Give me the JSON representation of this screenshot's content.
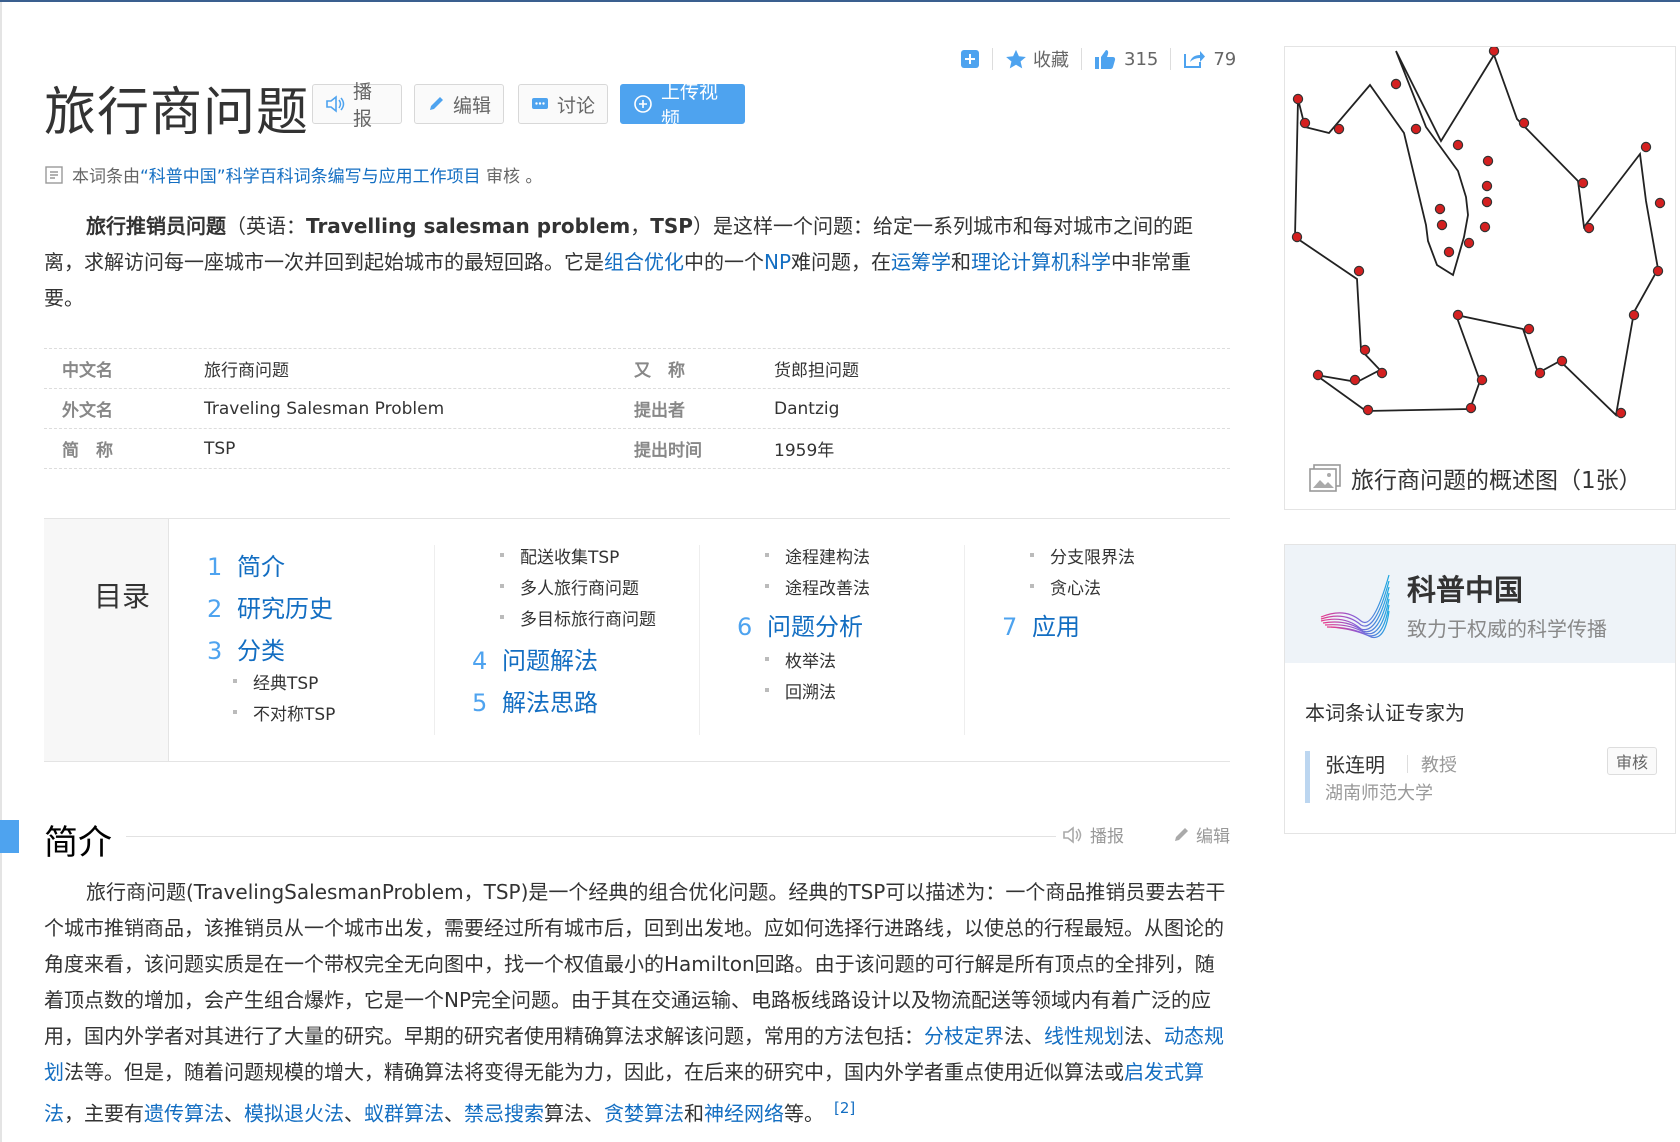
{
  "page": {
    "title": "旅行商问题",
    "buttons": {
      "broadcast": "播报",
      "edit": "编辑",
      "discuss": "讨论",
      "upload_video": "上传视频"
    },
    "top_actions": {
      "favorite": "收藏",
      "likes": "315",
      "shares": "79"
    },
    "review_note": {
      "prefix": "本词条由",
      "link": "“科普中国”科学百科词条编写与应用工作项目",
      "suffix": " 审核 。"
    }
  },
  "summary": {
    "bold_term": "旅行推销员问题",
    "part1": "（英语：",
    "english": "Travelling salesman problem",
    "part2": "，",
    "abbr": "TSP",
    "part3": "）是这样一个问题：给定一系列城市和每对城市之间的距离，求解访问每一座城市一次并回到起始城市的最短回路。它是",
    "link1": "组合优化",
    "part4": "中的一个",
    "link2": "NP",
    "part5": "难问题，在",
    "link3": "运筹学",
    "part6": "和",
    "link4": "理论计算机科学",
    "part7": "中非常重要。"
  },
  "info_table": [
    {
      "k1": "中文名",
      "v1": "旅行商问题",
      "k2": "又　称",
      "v2": "货郎担问题"
    },
    {
      "k1": "外文名",
      "v1": "Traveling Salesman Problem",
      "k2": "提出者",
      "v2": "Dantzig"
    },
    {
      "k1": "简　称",
      "v1": "TSP",
      "k2": "提出时间",
      "v2": "1959年"
    }
  ],
  "toc": {
    "label": "目录",
    "l1": [
      {
        "n": "1",
        "t": "简介"
      },
      {
        "n": "2",
        "t": "研究历史"
      },
      {
        "n": "3",
        "t": "分类"
      },
      {
        "n": "4",
        "t": "问题解法"
      },
      {
        "n": "5",
        "t": "解法思路"
      },
      {
        "n": "6",
        "t": "问题分析"
      },
      {
        "n": "7",
        "t": "应用"
      }
    ],
    "l2": [
      "经典TSP",
      "不对称TSP",
      "配送收集TSP",
      "多人旅行商问题",
      "多目标旅行商问题",
      "途程建构法",
      "途程改善法",
      "枚举法",
      "回溯法",
      "分支限界法",
      "贪心法"
    ]
  },
  "section": {
    "title": "简介",
    "broadcast": "播报",
    "edit": "编辑"
  },
  "intro": {
    "t1": "旅行商问题(TravelingSalesmanProblem，TSP)是一个经典的组合优化问题。经典的TSP可以描述为：一个商品推销员要去若干个城市推销商品，该推销员从一个城市出发，需要经过所有城市后，回到出发地。应如何选择行进路线，以使总的行程最短。从图论的角度来看，该问题实质是在一个带权完全无向图中，找一个权值最小的Hamilton回路。由于该问题的可行解是所有顶点的全排列，随着顶点数的增加，会产生组合爆炸，它是一个NP完全问题。由于其在交通运输、电路板线路设计以及物流配送等领域内有着广泛的应用，国内外学者对其进行了大量的研究。早期的研究者使用精确算法求解该问题，常用的方法包括：",
    "a1": "分枝定界",
    "t2": "法、",
    "a2": "线性规划",
    "t3": "法、",
    "a3": "动态规划",
    "t4": "法等。但是，随着问题规模的增大，精确算法将变得无能为力，因此，在后来的研究中，国内外学者重点使用近似算法或",
    "a4": "启发式算法",
    "t5": "，主要有",
    "a5": "遗传算法",
    "t6": "、",
    "a6": "模拟退火法",
    "t7": "、",
    "a7": "蚁群算法",
    "t8": "、",
    "a8": "禁忌搜索",
    "t9": "算法、",
    "a9": "贪婪算法",
    "t10": "和",
    "a10": "神经网络",
    "t11": "等。",
    "ref": "[2]"
  },
  "image_card": {
    "caption": "旅行商问题的概述图（1张）"
  },
  "kepu": {
    "name": "科普中国",
    "slogan": "致力于权威的科学传播",
    "expert_line": "本词条认证专家为",
    "expert_name": "张连明",
    "expert_title": "教授",
    "expert_org": "湖南师范大学",
    "badge": "审核"
  }
}
